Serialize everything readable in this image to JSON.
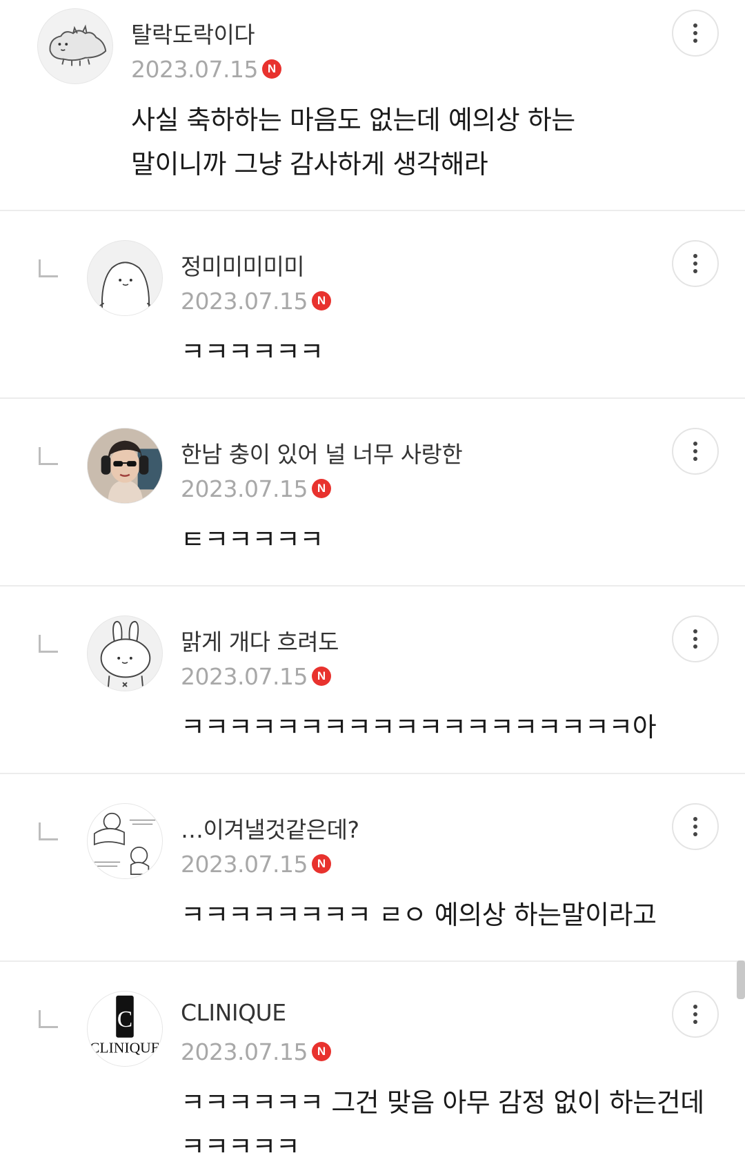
{
  "colors": {
    "badge": "#e8322e",
    "date": "#a8a8a8",
    "divider": "#ececec"
  },
  "comments": [
    {
      "nickname": "탈락도락이다",
      "date": "2023.07.15",
      "badge": "N",
      "avatar_icon": "dinosaur-doodle-icon",
      "text_lines": [
        "사실 축하하는 마음도 없는데 예의상 하는",
        "말이니까 그냥 감사하게 생각해라"
      ]
    },
    {
      "nickname": "정미미미미미",
      "date": "2023.07.15",
      "badge": "N",
      "avatar_icon": "seal-doodle-icon",
      "text_lines": [
        "ㅋㅋㅋㅋㅋㅋ"
      ]
    },
    {
      "nickname": "한남 충이 있어 널 너무 사랑한",
      "date": "2023.07.15",
      "badge": "N",
      "avatar_icon": "person-with-headphones-photo",
      "text_lines": [
        "ㅌㅋㅋㅋㅋㅋ"
      ]
    },
    {
      "nickname": "맑게 개다 흐려도",
      "date": "2023.07.15",
      "badge": "N",
      "avatar_icon": "bunny-doodle-icon",
      "text_lines": [
        "ㅋㅋㅋㅋㅋㅋㅋㅋㅋㅋㅋㅋㅋㅋㅋㅋㅋㅋㅋ아"
      ]
    },
    {
      "nickname": "…이겨낼것같은데?",
      "date": "2023.07.15",
      "badge": "N",
      "avatar_icon": "doodle-comic-icon",
      "text_lines": [
        "ㅋㅋㅋㅋㅋㅋㅋㅋ ㄹㅇ 예의상 하는말이라고"
      ]
    },
    {
      "nickname": "CLINIQUE",
      "date": "2023.07.15",
      "badge": "N",
      "avatar_icon": "clinique-logo",
      "avatar_logo_text": "CLINIQUE",
      "avatar_logo_letter": "C",
      "text_lines": [
        "ㅋㅋㅋㅋㅋㅋ 그건 맞음 아무 감정 없이 하는건데",
        "ㅋㅋㅋㅋㅋ"
      ]
    }
  ]
}
